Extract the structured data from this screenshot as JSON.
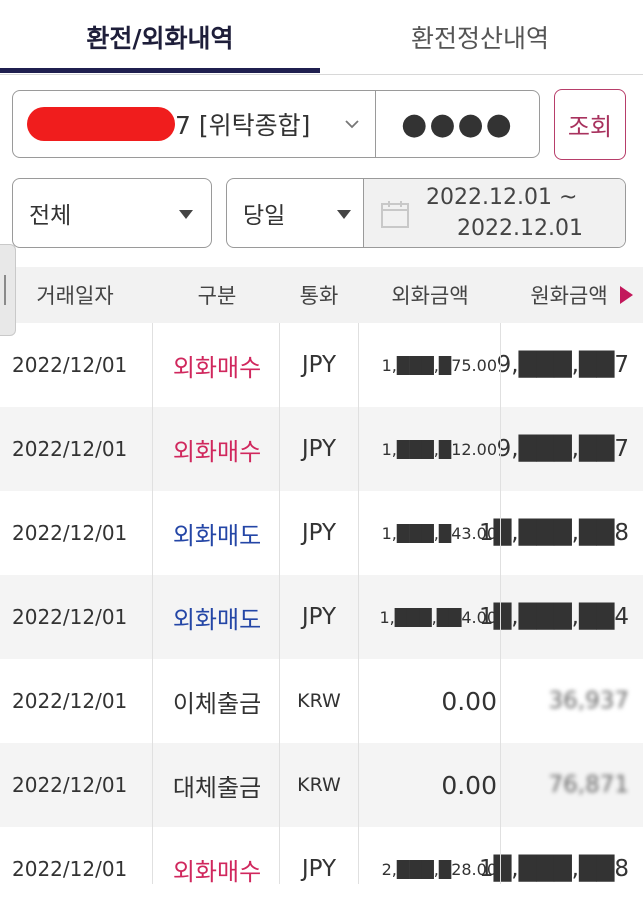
{
  "tabs": [
    {
      "label": "환전/외화내역",
      "active": true
    },
    {
      "label": "환전정산내역",
      "active": false
    }
  ],
  "account": {
    "number_suffix": "7 [위탁종합]",
    "password_mask": "●●●●",
    "inquiry_label": "조회"
  },
  "filter": {
    "type_value": "전체",
    "period_value": "당일",
    "date_from": "2022.12.01 ~",
    "date_to": "2022.12.01"
  },
  "table": {
    "headers": [
      "거래일자",
      "구분",
      "통화",
      "외화금액",
      "원화금액"
    ],
    "rows": [
      {
        "date": "2022/12/01",
        "type": "외화매수",
        "kind": "buy",
        "currency": "JPY",
        "fx": "1,███,█75.00",
        "krw": "9,███,██7"
      },
      {
        "date": "2022/12/01",
        "type": "외화매수",
        "kind": "buy",
        "currency": "JPY",
        "fx": "1,███,█12.00",
        "krw": "9,███,██7"
      },
      {
        "date": "2022/12/01",
        "type": "외화매도",
        "kind": "sell",
        "currency": "JPY",
        "fx": "1,███,█43.00",
        "krw": "1█,███,██8"
      },
      {
        "date": "2022/12/01",
        "type": "외화매도",
        "kind": "sell",
        "currency": "JPY",
        "fx": "1,███,██4.00",
        "krw": "1█,███,██4"
      },
      {
        "date": "2022/12/01",
        "type": "이체출금",
        "kind": "plain",
        "currency": "KRW",
        "fx": "0.00",
        "krw": "36,937"
      },
      {
        "date": "2022/12/01",
        "type": "대체출금",
        "kind": "plain",
        "currency": "KRW",
        "fx": "0.00",
        "krw": "76,871"
      },
      {
        "date": "2022/12/01",
        "type": "외화매수",
        "kind": "buy",
        "currency": "JPY",
        "fx": "2,███,█28.00",
        "krw": "1█,███,██8"
      }
    ]
  },
  "colors": {
    "accent": "#1f1f4f",
    "buy": "#d0275d",
    "sell": "#2446a6",
    "inquiry_border": "#b73e6a"
  }
}
